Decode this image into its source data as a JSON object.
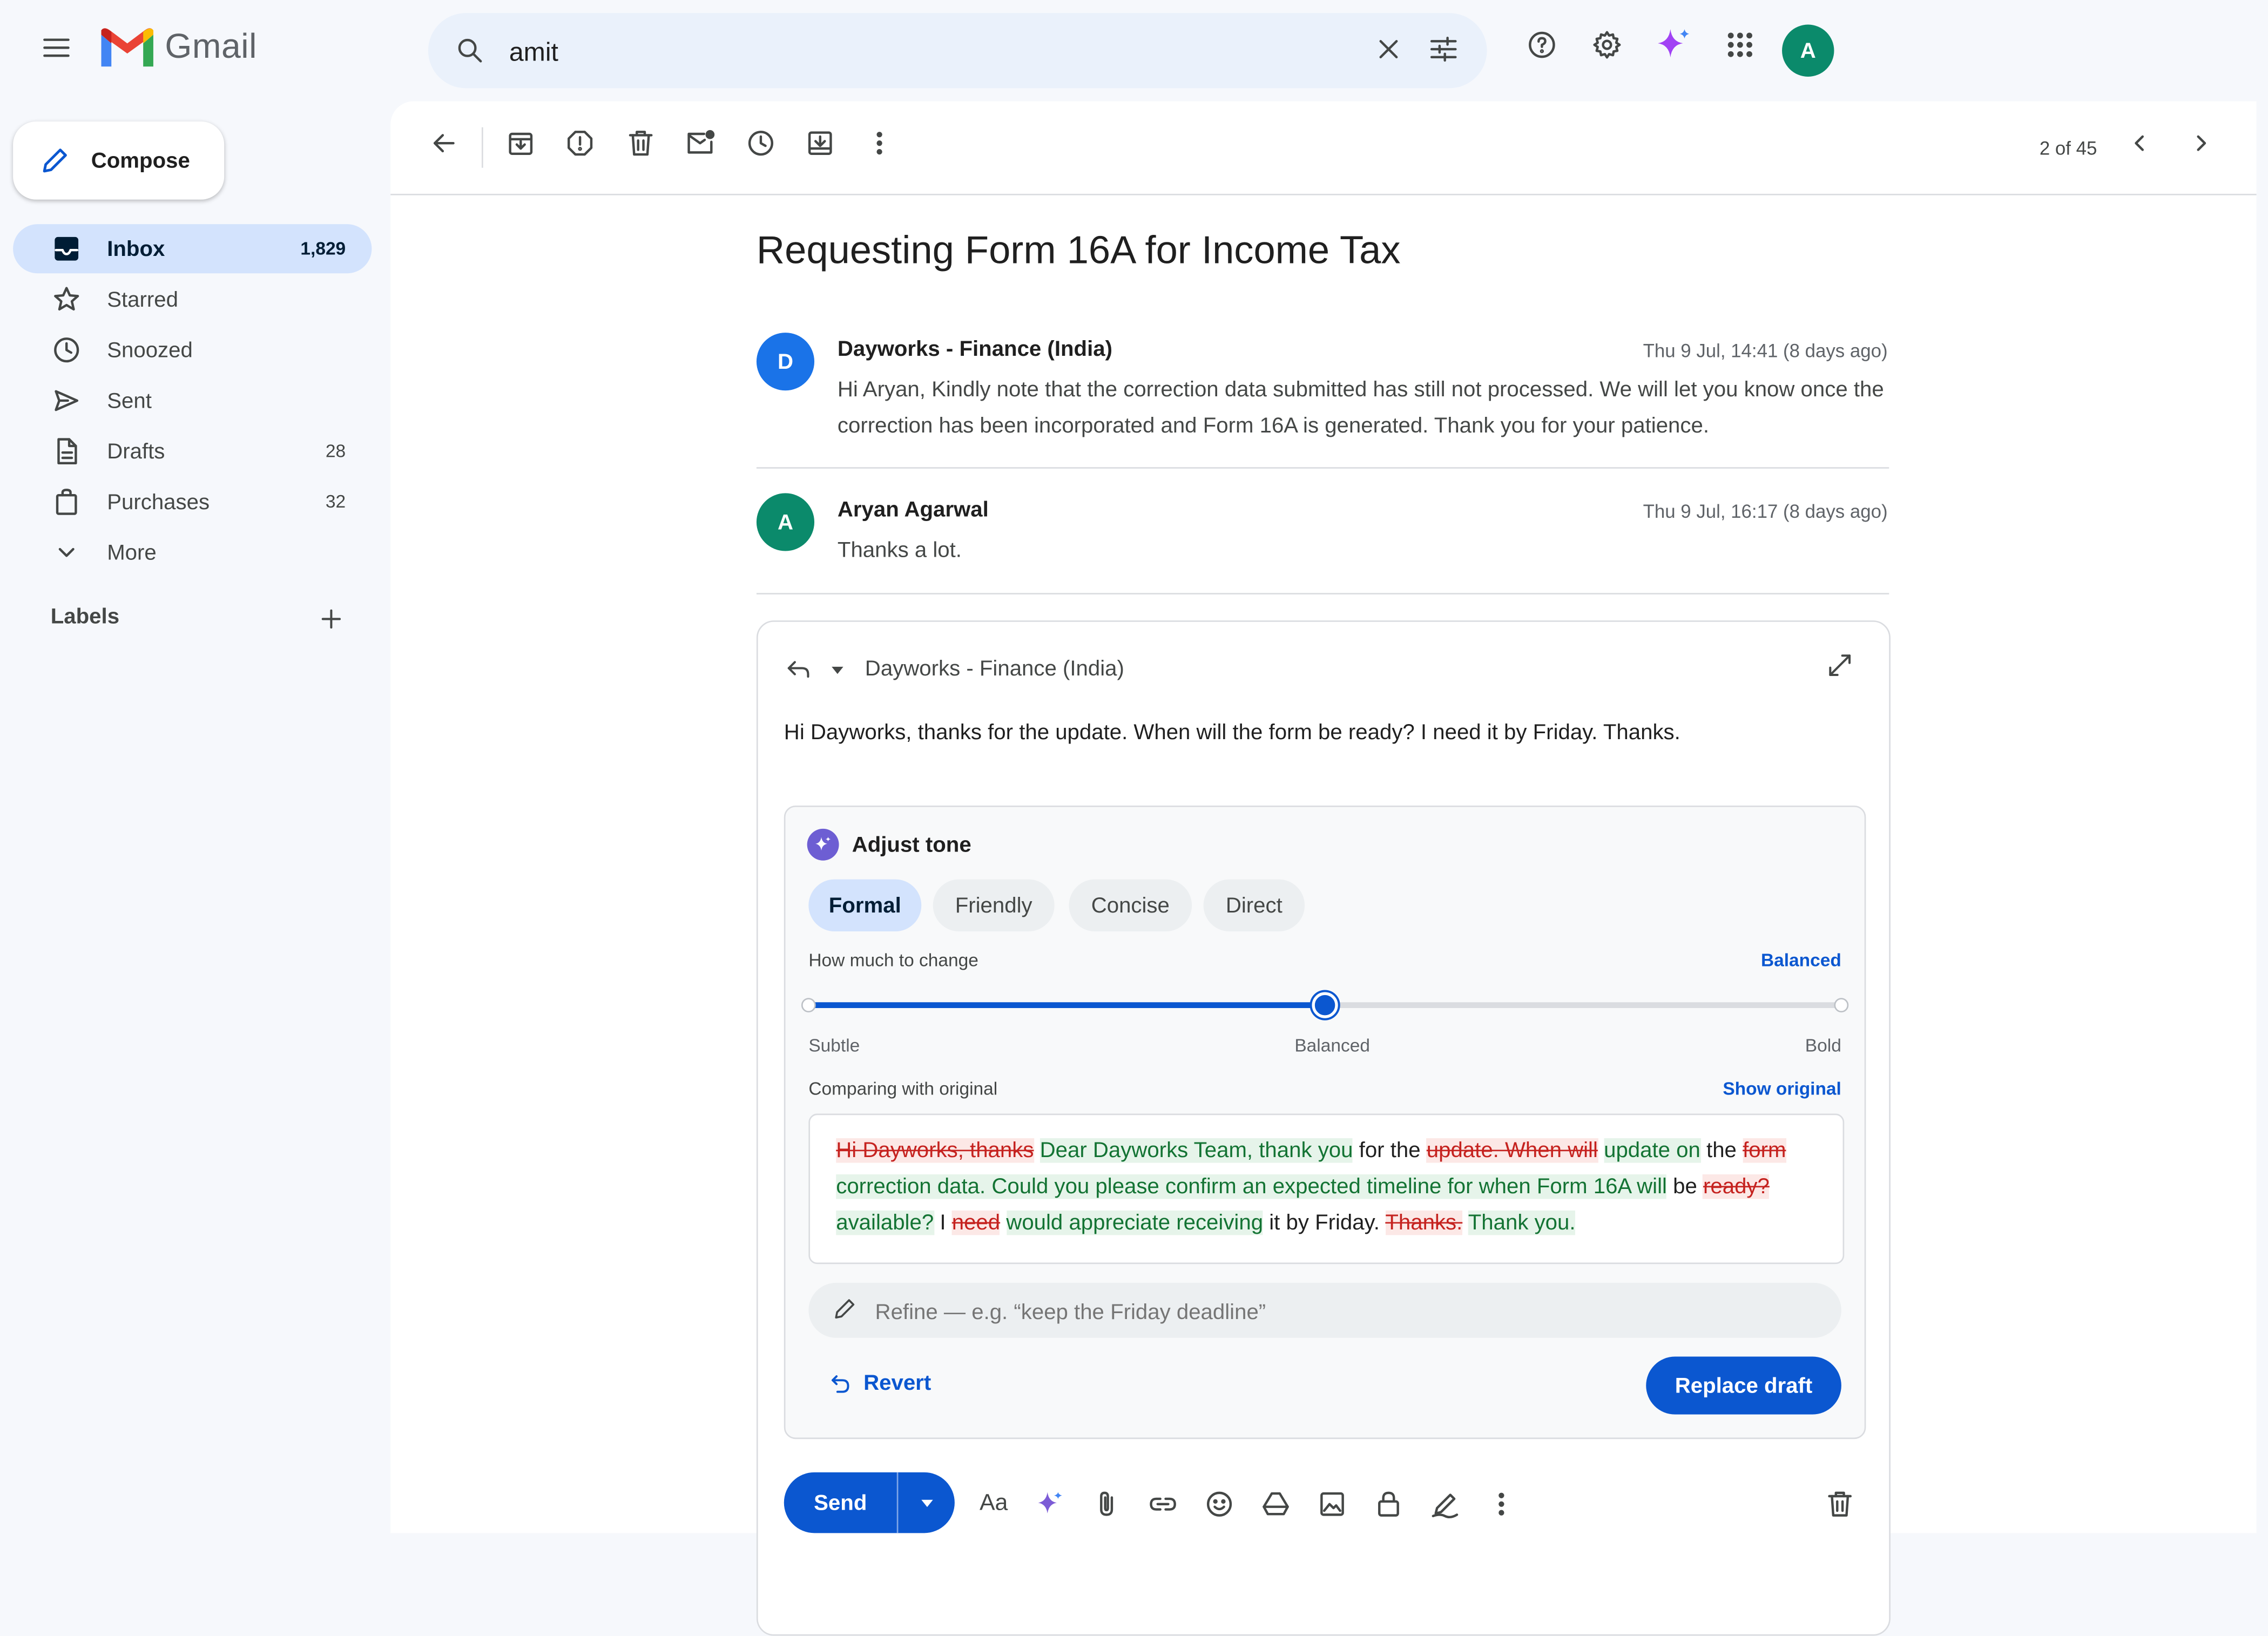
{
  "app": {
    "name": "Gmail",
    "colors": {
      "accent": "#0b57d0",
      "selected_nav": "#d3e3fd",
      "deleted_text": "#c5221f",
      "inserted_text": "#137333",
      "gemini": "#a142f4"
    }
  },
  "search": {
    "query": "amit",
    "icons": [
      "search-icon",
      "clear-icon",
      "filter-options-icon"
    ]
  },
  "topbar": {
    "account_initial": "A",
    "icons": [
      "help-icon",
      "settings-icon",
      "gemini-sparkle-icon",
      "apps-grid-icon"
    ]
  },
  "compose": {
    "label": "Compose"
  },
  "nav": [
    {
      "label": "Inbox",
      "count": "1,829",
      "icon": "inbox-icon"
    },
    {
      "label": "Starred",
      "count": "",
      "icon": "star-icon"
    },
    {
      "label": "Snoozed",
      "count": "",
      "icon": "clock-icon"
    },
    {
      "label": "Sent",
      "count": "",
      "icon": "send-icon"
    },
    {
      "label": "Drafts",
      "count": "28",
      "icon": "draft-icon"
    },
    {
      "label": "Purchases",
      "count": "32",
      "icon": "shopping-bag-icon"
    },
    {
      "label": "More",
      "count": "",
      "icon": "chevron-down-icon"
    }
  ],
  "labels": {
    "title": "Labels"
  },
  "pager": {
    "text": "2 of 45"
  },
  "thread": {
    "subject": "Requesting Form 16A for Income Tax",
    "messages": [
      {
        "initial": "D",
        "sender": "Dayworks - Finance (India)",
        "date": "Thu 9 Jul, 14:41 (8 days ago)",
        "body": "Hi Aryan, Kindly note that the correction data submitted has still not processed. We will let you know once the correction has been incorporated and Form 16A is generated. Thank you for your patience."
      },
      {
        "initial": "A",
        "sender": "Aryan Agarwal",
        "date": "Thu 9 Jul, 16:17 (8 days ago)",
        "body": "Thanks a lot."
      }
    ]
  },
  "reply": {
    "recipient": "Dayworks - Finance (India)",
    "draft": "Hi Dayworks, thanks for the update. When will the form be ready? I need it by Friday. Thanks.",
    "send_label": "Send"
  },
  "tone": {
    "title": "Adjust tone",
    "options": [
      "Formal",
      "Friendly",
      "Concise",
      "Direct"
    ],
    "selected": "Formal",
    "strength_label": "How much to change",
    "strength_value": "Balanced",
    "strength_level": 0.5,
    "scale": [
      "Subtle",
      "Balanced",
      "Bold"
    ],
    "compare_label": "Comparing with original",
    "show_original": "Show original",
    "diff": [
      {
        "t": "del",
        "text": "Hi Dayworks, thanks"
      },
      {
        "t": "ins",
        "text": "Dear Dayworks Team, thank you"
      },
      {
        "t": "same",
        "text": "for the"
      },
      {
        "t": "del",
        "text": "update. When will"
      },
      {
        "t": "ins",
        "text": "update on"
      },
      {
        "t": "same",
        "text": "the"
      },
      {
        "t": "del",
        "text": "form"
      },
      {
        "t": "ins",
        "text": "correction data. Could you please confirm an expected timeline for when Form 16A will"
      },
      {
        "t": "same",
        "text": "be"
      },
      {
        "t": "del",
        "text": "ready?"
      },
      {
        "t": "ins",
        "text": "available?"
      },
      {
        "t": "same",
        "text": "I"
      },
      {
        "t": "del",
        "text": "need"
      },
      {
        "t": "ins",
        "text": "would appreciate receiving"
      },
      {
        "t": "same",
        "text": "it by Friday."
      },
      {
        "t": "del",
        "text": "Thanks."
      },
      {
        "t": "ins",
        "text": "Thank you."
      }
    ],
    "refine_placeholder": "Refine — e.g. “keep the Friday deadline”",
    "revert_label": "Revert",
    "replace_label": "Replace draft"
  }
}
